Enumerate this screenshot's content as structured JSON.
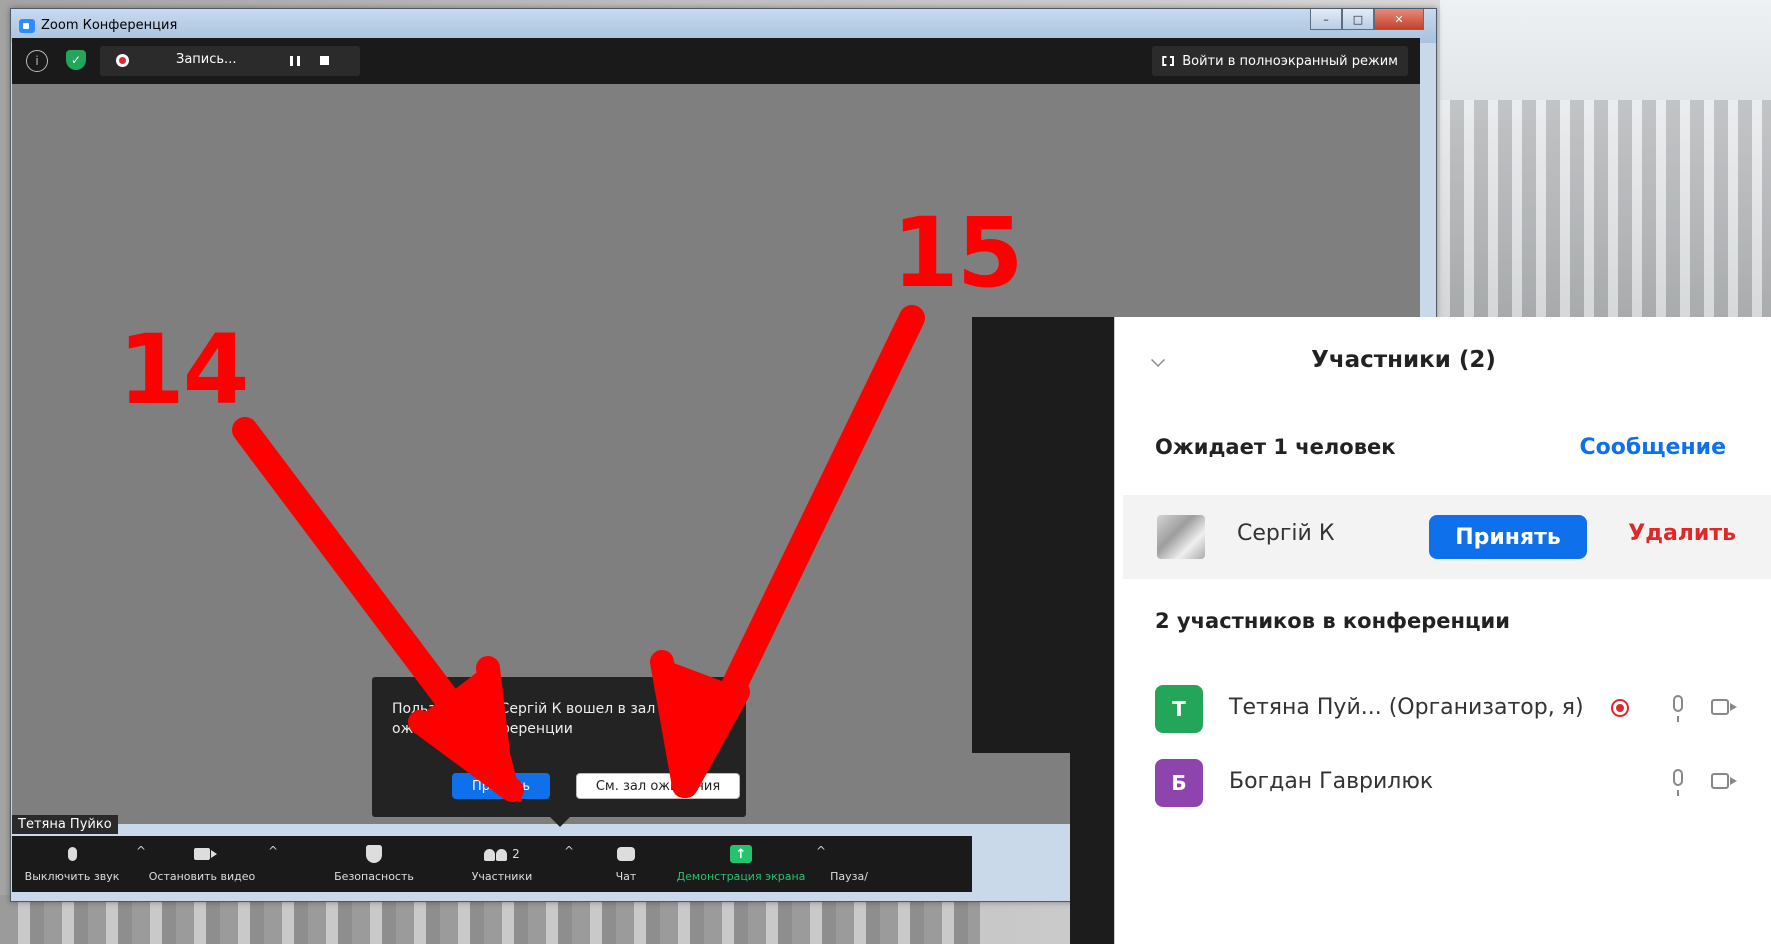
{
  "window": {
    "title": "Zoom Конференция",
    "controls": {
      "minimize": "–",
      "maximize": "□",
      "close": "✕"
    }
  },
  "topbar": {
    "info_icon": "info-icon",
    "security_icon": "shield-icon",
    "recording_label": "Запись...",
    "fullscreen_label": "Войти в полноэкранный режим"
  },
  "video": {
    "name_tag": "Тетяна Пуйко"
  },
  "toolbar": {
    "mute": "Выключить звук",
    "stop_video": "Остановить видео",
    "security": "Безопасность",
    "participants": "Участники",
    "participants_count": "2",
    "chat": "Чат",
    "share": "Демонстрация экрана",
    "pause": "Пауза/"
  },
  "notification": {
    "text": "Пользователь Сергій К вошел в зал ожидания конференции",
    "accept_label": "Принять",
    "waiting_label": "См. зал ожидания"
  },
  "panel": {
    "title": "Участники (2)",
    "waiting_header": "Ожидает 1 человек",
    "message_link": "Сообщение",
    "waiting_person": {
      "name": "Сергій К",
      "accept_label": "Принять",
      "remove_label": "Удалить"
    },
    "in_conference_header": "2 участников в конференции",
    "participants": [
      {
        "initial": "Т",
        "name": "Тетяна Пуй... (Организатор, я)",
        "color": "#23a55a",
        "recording": true
      },
      {
        "initial": "Б",
        "name": "Богдан Гаврилюк",
        "color": "#8e44ad",
        "recording": false
      }
    ]
  },
  "annotations": {
    "step_a": "14",
    "step_b": "15",
    "color": "#ff0000"
  }
}
